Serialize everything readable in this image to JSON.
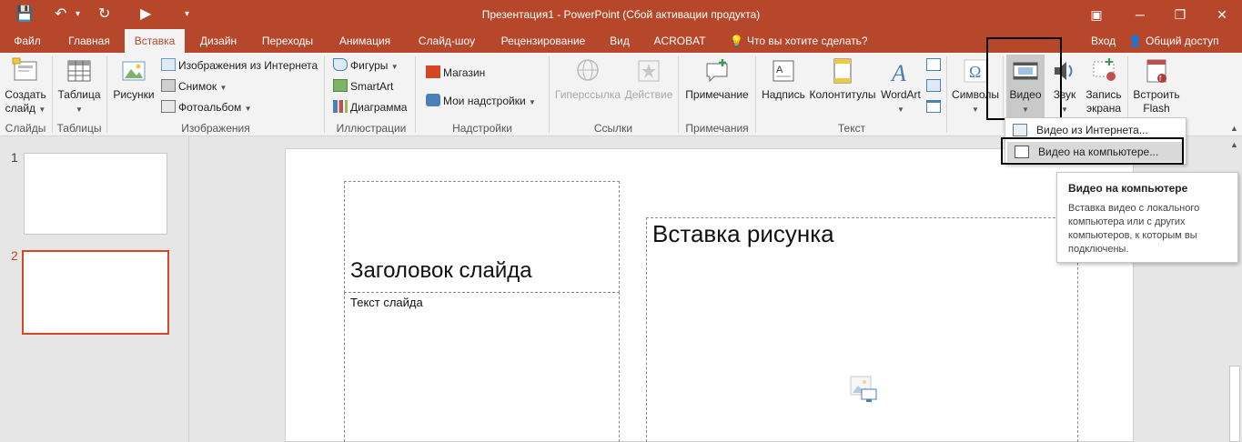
{
  "title": "Презентация1 - PowerPoint (Сбой активации продукта)",
  "quick_access": {
    "save": "💾",
    "undo": "↶",
    "undo_caret": "▾",
    "redo": "↻",
    "present": "▶",
    "customize": "▾"
  },
  "window_controls": {
    "ribbon_options": "▣",
    "minimize": "─",
    "restore": "❐",
    "close": "✕"
  },
  "tabs": [
    {
      "label": "Файл"
    },
    {
      "label": "Главная"
    },
    {
      "label": "Вставка",
      "active": true
    },
    {
      "label": "Дизайн"
    },
    {
      "label": "Переходы"
    },
    {
      "label": "Анимация"
    },
    {
      "label": "Слайд-шоу"
    },
    {
      "label": "Рецензирование"
    },
    {
      "label": "Вид"
    },
    {
      "label": "ACROBAT"
    }
  ],
  "tell_me": "Что вы хотите сделать?",
  "login": "Вход",
  "share": "Общий доступ",
  "ribbon": {
    "new_slide": [
      "Создать",
      "слайд"
    ],
    "table": "Таблица",
    "pictures": "Рисунки",
    "online_pictures": "Изображения из Интернета",
    "screenshot": "Снимок",
    "photo_album": "Фотоальбом",
    "shapes": "Фигуры",
    "smartart": "SmartArt",
    "chart": "Диаграмма",
    "store": "Магазин",
    "my_addins": "Мои надстройки",
    "hyperlink": "Гиперссылка",
    "action": "Действие",
    "comment": "Примечание",
    "textbox": "Надпись",
    "header_footer": "Колонтитулы",
    "wordart": "WordArt",
    "symbols": "Символы",
    "video": "Видео",
    "audio": "Звук",
    "screen_recording": [
      "Запись",
      "экрана"
    ],
    "embed_flash": [
      "Встроить",
      "Flash"
    ],
    "groups": {
      "slides": "Слайды",
      "tables": "Таблицы",
      "images": "Изображения",
      "illustrations": "Иллюстрации",
      "addins": "Надстройки",
      "links": "Ссылки",
      "comments": "Примечания",
      "text": "Текст"
    }
  },
  "dropdown": {
    "online_video": "Видео из Интернета...",
    "video_on_pc": "Видео на компьютере..."
  },
  "tooltip": {
    "title": "Видео на компьютере",
    "body": "Вставка видео с локального компьютера или с других компьютеров, к которым вы подключены."
  },
  "thumbnails": [
    {
      "number": "1"
    },
    {
      "number": "2",
      "active": true
    }
  ],
  "slide": {
    "title": "Заголовок слайда",
    "body": "Текст слайда",
    "right_title": "Вставка рисунка"
  },
  "colors": {
    "accent": "#b7472a",
    "selection": "#d24726"
  }
}
